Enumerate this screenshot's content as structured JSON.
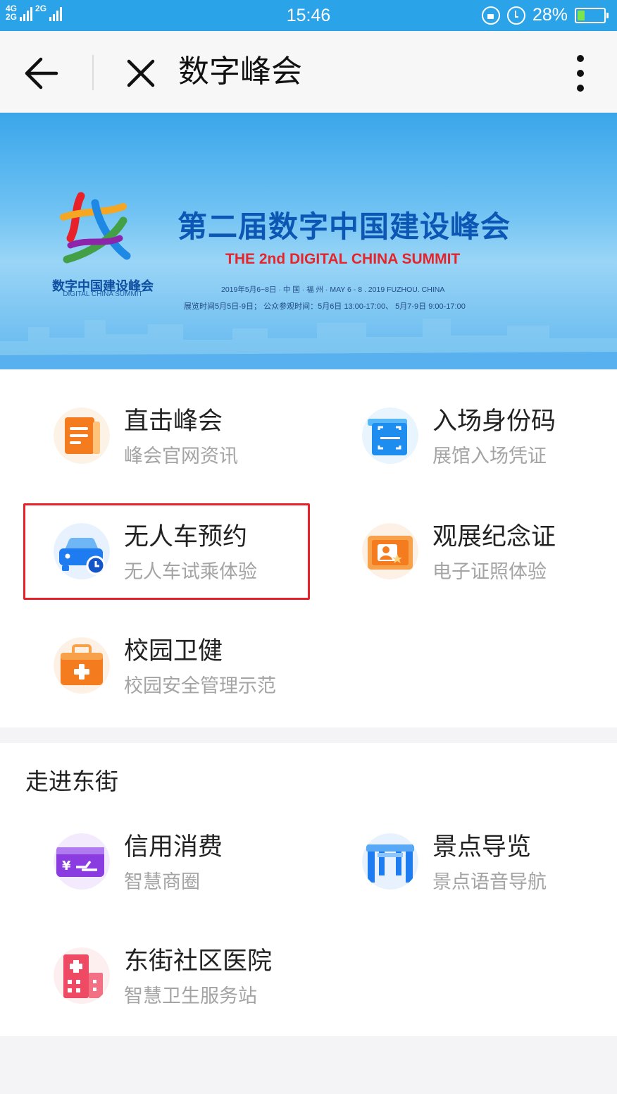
{
  "status_bar": {
    "network_top": "4G",
    "network_bottom": "2G",
    "network_right": "2G",
    "time": "15:46",
    "battery": "28%",
    "battery_level": 0.28
  },
  "nav": {
    "title": "数字峰会"
  },
  "banner": {
    "title": "第二届数字中国建设峰会",
    "subtitle_en": "THE 2nd DIGITAL CHINA SUMMIT",
    "logo_text": "数字中国建设峰会",
    "logo_subtext": "DIGITAL CHINA SUMMIT",
    "dates_line": "2019年5月6~8日 · 中 国 · 福 州 · MAY 6 - 8 . 2019 FUZHOU. CHINA",
    "hours_line": "展览时间5月5日-9日； 公众参观时间：5月6日 13:00-17:00、 5月7-9日 9:00-17:00"
  },
  "summit_items": [
    {
      "title": "直击峰会",
      "sub": "峰会官网资讯",
      "icon": "document-icon"
    },
    {
      "title": "入场身份码",
      "sub": "展馆入场凭证",
      "icon": "qr-scan-icon"
    },
    {
      "title": "无人车预约",
      "sub": "无人车试乘体验",
      "icon": "car-clock-icon"
    },
    {
      "title": "观展纪念证",
      "sub": "电子证照体验",
      "icon": "certificate-icon"
    },
    {
      "title": "校园卫健",
      "sub": "校园安全管理示范",
      "icon": "medical-kit-icon"
    }
  ],
  "dongjie": {
    "title": "走进东街",
    "items": [
      {
        "title": "信用消费",
        "sub": "智慧商圈",
        "icon": "credit-card-icon"
      },
      {
        "title": "景点导览",
        "sub": "景点语音导航",
        "icon": "gate-icon"
      },
      {
        "title": "东街社区医院",
        "sub": "智慧卫生服务站",
        "icon": "hospital-icon"
      }
    ]
  },
  "colors": {
    "status_bar": "#2aa3e8",
    "highlight": "#e8202a",
    "orange": "#f57b1f",
    "blue": "#1e8df0",
    "purple": "#8a3ce0",
    "pink": "#ef4a63"
  }
}
